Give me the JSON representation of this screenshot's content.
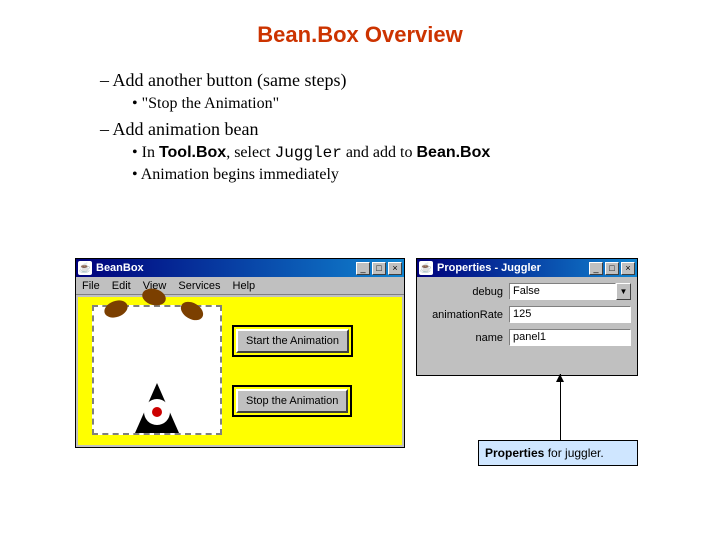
{
  "title": "Bean.Box Overview",
  "bullets": {
    "b1": "Add another button (same steps)",
    "b1a": "\"Stop the Animation\"",
    "b2": "Add animation bean",
    "b2a_pre": "In ",
    "b2a_tool": "Tool.Box",
    "b2a_mid": ", select ",
    "b2a_code": "Juggler",
    "b2a_mid2": " and add to ",
    "b2a_tool2": "Bean.Box",
    "b2b": "Animation begins immediately"
  },
  "beanbox": {
    "title": "BeanBox",
    "menu": {
      "file": "File",
      "edit": "Edit",
      "view": "View",
      "services": "Services",
      "help": "Help"
    },
    "start_btn": "Start the Animation",
    "stop_btn": "Stop the Animation"
  },
  "props": {
    "title": "Properties - Juggler",
    "rows": [
      {
        "label": "debug",
        "value": "False",
        "type": "select"
      },
      {
        "label": "animationRate",
        "value": "125",
        "type": "text"
      },
      {
        "label": "name",
        "value": "panel1",
        "type": "text"
      }
    ]
  },
  "winbtns": {
    "min": "_",
    "max": "□",
    "close": "×"
  },
  "callout": {
    "bold": "Properties",
    "rest": " for juggler."
  }
}
